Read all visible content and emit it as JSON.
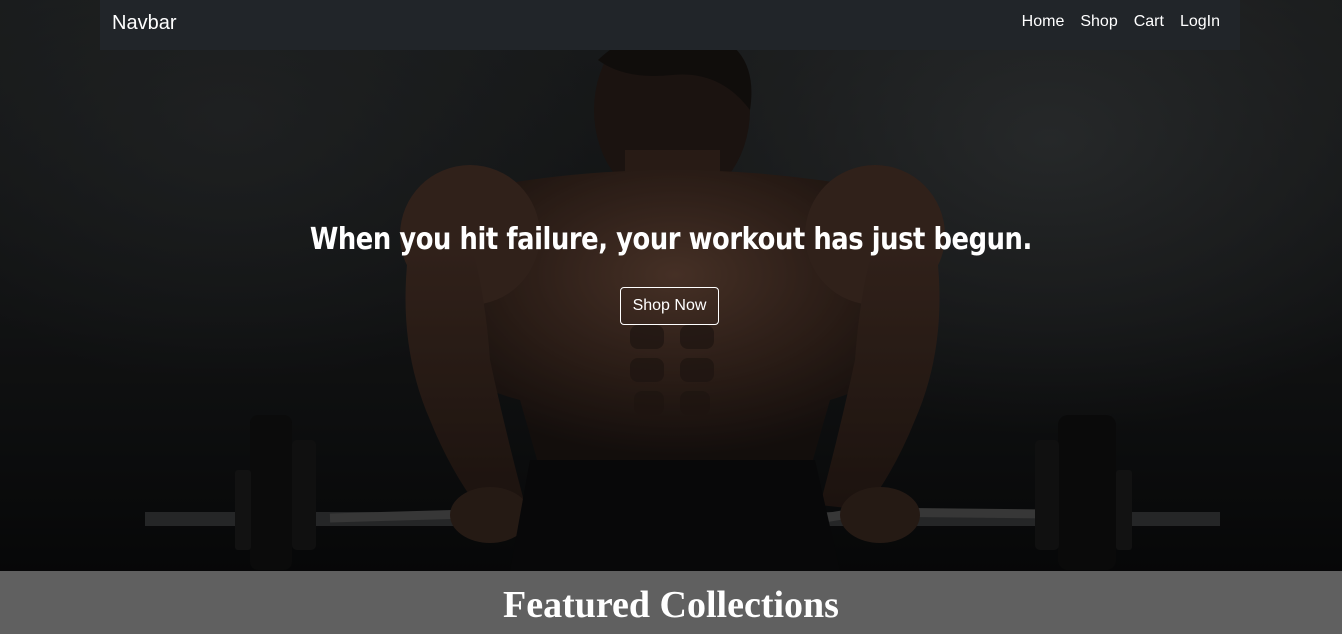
{
  "navbar": {
    "brand": "Navbar",
    "links": [
      "Home",
      "Shop",
      "Cart",
      "LogIn"
    ]
  },
  "hero": {
    "headline": "When you hit failure, your workout has just begun.",
    "button_label": "Shop Now",
    "image": "bodybuilder-lifting-barbell-photo"
  },
  "featured": {
    "title": "Featured Collections"
  },
  "colors": {
    "navbar_bg": "#212529",
    "featured_bg": "#606060",
    "text": "#ffffff"
  }
}
